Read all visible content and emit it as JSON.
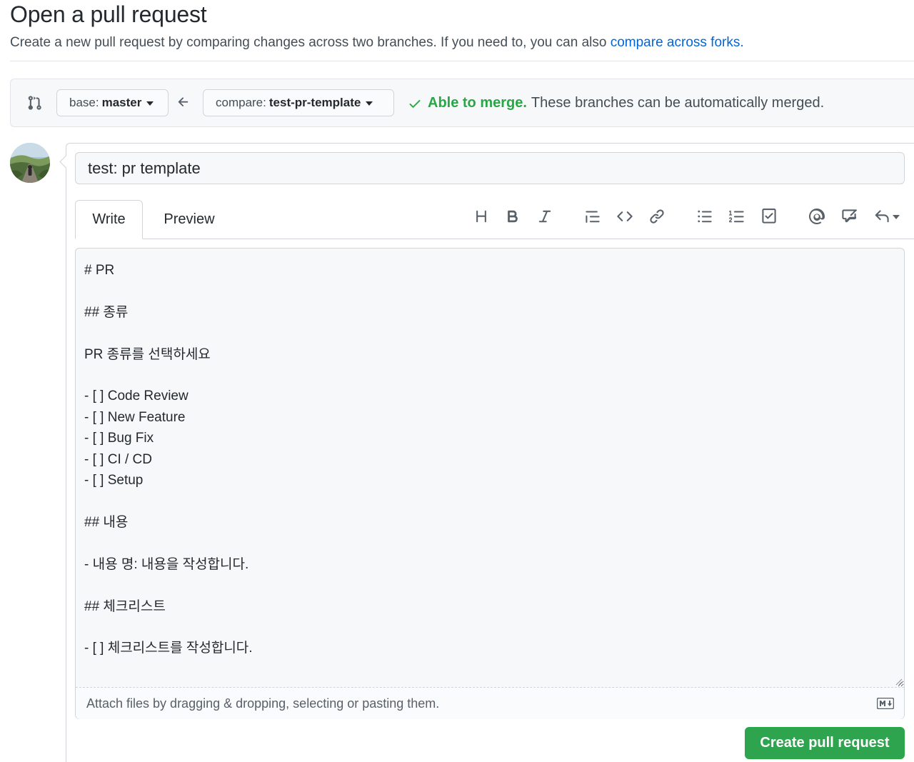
{
  "header": {
    "title": "Open a pull request",
    "subtitle": "Create a new pull request by comparing changes across two branches. If you need to, you can also ",
    "forks_link": "compare across forks."
  },
  "range": {
    "base_label": "base:",
    "base_value": "master",
    "compare_label": "compare:",
    "compare_value": "test-pr-template",
    "merge_ok": "Able to merge.",
    "merge_text": "These branches can be automatically merged."
  },
  "form": {
    "title_value": "test: pr template",
    "tabs": [
      "Write",
      "Preview"
    ],
    "toolbar_icons": [
      "heading-icon",
      "bold-icon",
      "italic-icon",
      "quote-icon",
      "code-icon",
      "link-icon",
      "unordered-list-icon",
      "ordered-list-icon",
      "task-list-icon",
      "mention-icon",
      "cross-reference-icon",
      "reply-icon"
    ],
    "body": "# PR\n\n## 종류\n\nPR 종류를 선택하세요\n\n- [ ] Code Review\n- [ ] New Feature\n- [ ] Bug Fix\n- [ ] CI / CD\n- [ ] Setup\n\n## 내용\n\n- 내용 명: 내용을 작성합니다.\n\n## 체크리스트\n\n- [ ] 체크리스트를 작성합니다.",
    "attach_text": "Attach files by dragging & dropping, selecting or pasting them.",
    "submit_label": "Create pull request"
  },
  "colors": {
    "link": "#0366d6",
    "success": "#28a745",
    "button_green": "#2ea44f"
  }
}
